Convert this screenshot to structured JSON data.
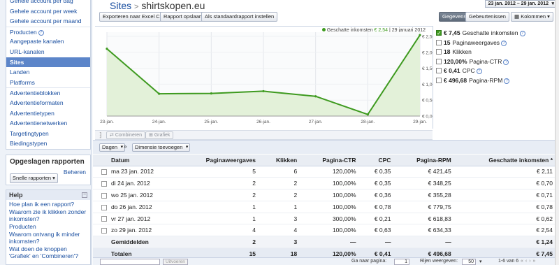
{
  "sidebar": {
    "nav_items": [
      {
        "label": "Gehele account per dag",
        "active": false,
        "sep": false
      },
      {
        "label": "Gehele account per week",
        "active": false,
        "sep": false
      },
      {
        "label": "Gehele account per maand",
        "active": false,
        "sep": false
      },
      {
        "label": "Producten",
        "active": false,
        "sep": true,
        "help": true
      },
      {
        "label": "Aangepaste kanalen",
        "active": false,
        "sep": false
      },
      {
        "label": "URL-kanalen",
        "active": false,
        "sep": false
      },
      {
        "label": "Sites",
        "active": true,
        "sep": false
      },
      {
        "label": "Landen",
        "active": false,
        "sep": false
      },
      {
        "label": "Platforms",
        "active": false,
        "sep": false
      },
      {
        "label": "Advertentieblokken",
        "active": false,
        "sep": true
      },
      {
        "label": "Advertentieformaten",
        "active": false,
        "sep": false
      },
      {
        "label": "Advertentietypen",
        "active": false,
        "sep": false
      },
      {
        "label": "Advertentienetwerken",
        "active": false,
        "sep": false
      },
      {
        "label": "Targetingtypen",
        "active": false,
        "sep": false
      },
      {
        "label": "Biedingstypen",
        "active": false,
        "sep": false
      }
    ],
    "saved_reports": {
      "title": "Opgeslagen rapporten",
      "manage": "Beheren",
      "quick": "Snelle rapporten"
    },
    "help": {
      "title": "Help",
      "close": "−",
      "links": [
        "Hoe plan ik een rapport?",
        "Waarom zie ik klikken zonder inkomsten?",
        "Producten",
        "Waarom ontvang ik minder inkomsten?",
        "Wat doen de knoppen 'Grafiek' en 'Combineren'?"
      ]
    }
  },
  "header": {
    "crumb": "Sites",
    "separator": ">",
    "site": "shirtskopen.eu",
    "date_range": "23 jan. 2012 – 29 jan. 2012"
  },
  "toolbar": {
    "export_csv": "Exporteren naar Excel CSV",
    "save_report": "Rapport opslaan",
    "set_default": "Als standaardrapport instellen",
    "data_tab": "Gegevens",
    "events_tab": "Gebeurtenissen",
    "columns": "Kolommen"
  },
  "chart_legend": {
    "label": "Geschatte inkomsten",
    "value": "€ 2,54",
    "date": "29 januari 2012"
  },
  "chart_data": {
    "type": "area",
    "categories": [
      "23-jan.",
      "24-jan.",
      "25-jan.",
      "26-jan.",
      "27-jan.",
      "28-jan.",
      "29-jan."
    ],
    "series": [
      {
        "name": "Geschatte inkomsten",
        "values": [
          2.11,
          0.7,
          0.71,
          0.78,
          0.62,
          0.05,
          2.54
        ],
        "color": "#3e9a1f"
      }
    ],
    "yticks": [
      "€ 0,00",
      "€ 0,50",
      "€ 1,00",
      "€ 1,50",
      "€ 2,00",
      "€ 2,50"
    ],
    "ylim": [
      0,
      2.5
    ],
    "grid": true
  },
  "metrics": [
    {
      "value": "€ 7,45",
      "label": "Geschatte inkomsten",
      "checked": true,
      "help": true
    },
    {
      "value": "15",
      "label": "Paginaweergaves",
      "checked": false,
      "help": true
    },
    {
      "value": "18",
      "label": "Klikken",
      "checked": false,
      "help": false
    },
    {
      "value": "120,00%",
      "label": "Pagina-CTR",
      "checked": false,
      "help": true
    },
    {
      "value": "€ 0,41",
      "label": "CPC",
      "checked": false,
      "help": true
    },
    {
      "value": "€ 496,68",
      "label": "Pagina-RPM",
      "checked": false,
      "help": true
    }
  ],
  "chart_tools": {
    "combine": "Combineren",
    "graph": "Grafiek"
  },
  "filters": {
    "days": "Dagen",
    "add_dimension": "Dimensie toevoegen"
  },
  "table": {
    "headers": [
      "Datum",
      "Paginaweergaves",
      "Klikken",
      "Pagina-CTR",
      "CPC",
      "Pagina-RPM",
      "Geschatte inkomsten *"
    ],
    "rows": [
      [
        "ma 23 jan. 2012",
        "5",
        "6",
        "120,00%",
        "€ 0,35",
        "€ 421,45",
        "€ 2,11"
      ],
      [
        "di 24 jan. 2012",
        "2",
        "2",
        "100,00%",
        "€ 0,35",
        "€ 348,25",
        "€ 0,70"
      ],
      [
        "wo 25 jan. 2012",
        "2",
        "2",
        "100,00%",
        "€ 0,36",
        "€ 355,28",
        "€ 0,71"
      ],
      [
        "do 26 jan. 2012",
        "1",
        "1",
        "100,00%",
        "€ 0,78",
        "€ 779,75",
        "€ 0,78"
      ],
      [
        "vr 27 jan. 2012",
        "1",
        "3",
        "300,00%",
        "€ 0,21",
        "€ 618,83",
        "€ 0,62"
      ],
      [
        "zo 29 jan. 2012",
        "4",
        "4",
        "100,00%",
        "€ 0,63",
        "€ 634,33",
        "€ 2,54"
      ]
    ],
    "averages": [
      "Gemiddelden",
      "2",
      "3",
      "—",
      "—",
      "—",
      "€ 1,24"
    ],
    "totals": [
      "Totalen",
      "15",
      "18",
      "120,00%",
      "€ 0,41",
      "€ 496,68",
      "€ 7,45"
    ]
  },
  "pager": {
    "apply": "Uitvoeren",
    "goto_label": "Ga naar pagina:",
    "page": "1",
    "rows_label": "Rijen weergeven:",
    "rows": "50",
    "range": "1-6 van 6"
  }
}
